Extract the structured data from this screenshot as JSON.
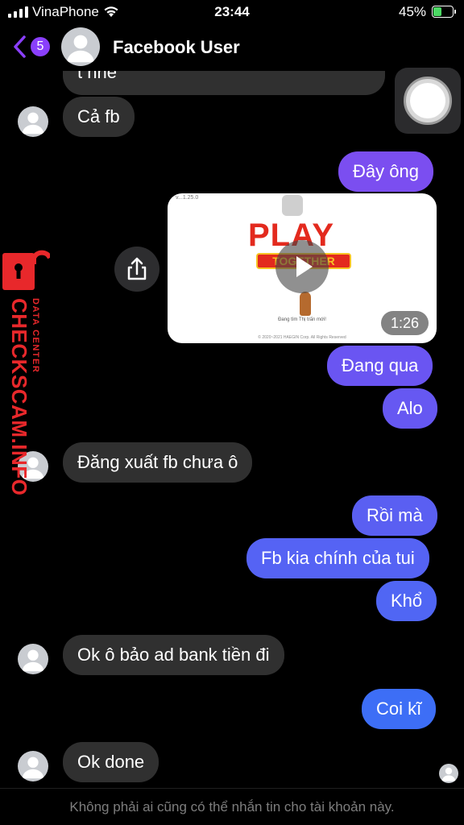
{
  "status_bar": {
    "carrier": "VinaPhone",
    "time": "23:44",
    "battery_percent": "45%",
    "battery_level": 0.45,
    "signal_bars": 4
  },
  "header": {
    "unread_count": "5",
    "contact_name": "Facebook User"
  },
  "messages": {
    "clipped_prev": "t nhe",
    "m1": "Cả fb",
    "m2": "Đây ông",
    "m3": "Đang qua",
    "m4": "Alo",
    "m5": "Đăng xuất fb chưa ô",
    "m6": "Rồi mà",
    "m7": "Fb kia chính của tui",
    "m8": "Khổ",
    "m9": "Ok ô bảo ad bank tiền đi",
    "m10": "Coi kĩ",
    "m11": "Ok done"
  },
  "video": {
    "version": "v...1.25.0",
    "game_title": "PLAY",
    "game_subtitle": "TOGETHER",
    "caption": "Đang tìm Thị trấn mới!",
    "copyright": "© 2020~2021 HAEGIN Corp. All Rights Reserved",
    "duration": "1:26"
  },
  "watermark": {
    "brand": "CHECKSCAM.INFO",
    "tagline": "DATA CENTER"
  },
  "footer": {
    "notice": "Không phải ai cũng có thể nhắn tin cho tài khoản này."
  },
  "colors": {
    "incoming_bubble": "#303030",
    "outgoing_bubble": "#5b5ef0",
    "accent": "#8a3ffc",
    "watermark": "#e8282b"
  },
  "icons": [
    "back-chevron-icon",
    "wifi-icon",
    "battery-icon",
    "share-icon",
    "play-icon",
    "assistive-touch-icon",
    "lock-icon"
  ]
}
